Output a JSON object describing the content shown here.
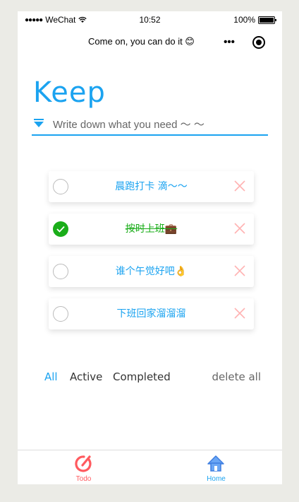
{
  "status_bar": {
    "carrier": "WeChat",
    "time": "10:52",
    "battery": "100%"
  },
  "nav": {
    "title": "Come on, you can do it 😊",
    "more_label": "•••"
  },
  "app": {
    "title": "Keep",
    "input_placeholder": "Write down what you need ～ ～",
    "input_value": ""
  },
  "todos": [
    {
      "text": "晨跑打卡 滴～～",
      "completed": false
    },
    {
      "text": "按时上班💼",
      "completed": true
    },
    {
      "text": "谁个午觉好吧👌",
      "completed": false
    },
    {
      "text": "下班回家溜溜溜",
      "completed": false
    }
  ],
  "filters": {
    "all": "All",
    "active": "Active",
    "completed": "Completed",
    "selected": "all",
    "delete_all": "delete all"
  },
  "tabbar": {
    "items": [
      {
        "label": "Todo",
        "icon": "todo-ring-icon",
        "color": "#ff5a5f"
      },
      {
        "label": "Home",
        "icon": "home-icon",
        "color": "#1ba3f0"
      }
    ]
  },
  "colors": {
    "accent": "#1ba3f0",
    "done": "#1aad19",
    "delete": "#ffb3b3",
    "todo_tab": "#ff5a5f"
  }
}
